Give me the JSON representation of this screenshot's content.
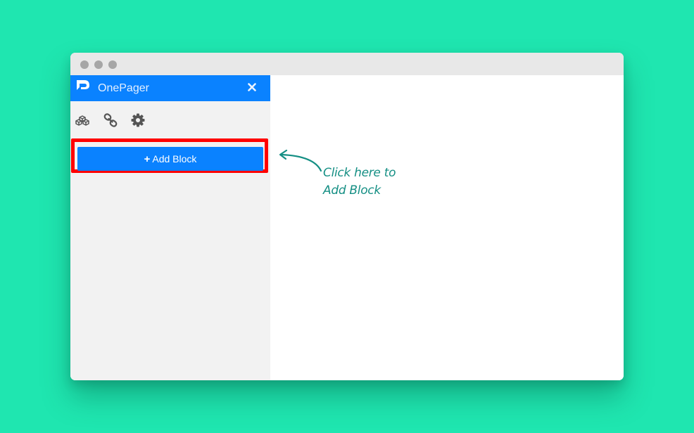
{
  "window": {
    "titlebar_dots": [
      "dot-1",
      "dot-2",
      "dot-3"
    ]
  },
  "sidebar": {
    "header": {
      "logo_icon": "onepager-logo-icon",
      "title": "OnePager",
      "close_icon": "close-icon"
    },
    "toolbar": [
      {
        "icon": "blocks-icon",
        "label": "Blocks"
      },
      {
        "icon": "link-icon",
        "label": "Link"
      },
      {
        "icon": "gear-icon",
        "label": "Settings"
      }
    ],
    "add_block_button": {
      "icon": "plus-icon",
      "label": "Add Block"
    }
  },
  "annotation": {
    "line1": "Click here to",
    "line2": "Add Block",
    "arrow_icon": "curved-arrow-icon"
  },
  "colors": {
    "background": "#1fe6b0",
    "accent": "#0a82ff",
    "highlight": "#ff0000",
    "annotation": "#158f84",
    "sidebar": "#f2f2f2",
    "titlebar": "#e8e8e8"
  }
}
